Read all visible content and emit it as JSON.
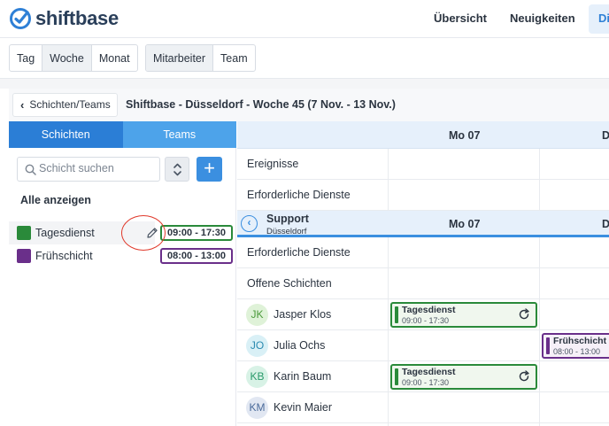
{
  "app": {
    "brand": "shiftbase"
  },
  "topnav": {
    "links": [
      "Übersicht",
      "Neuigkeiten",
      "Di"
    ]
  },
  "toolbar": {
    "view_modes": [
      "Tag",
      "Woche",
      "Monat"
    ],
    "view_active": "Woche",
    "group_modes": [
      "Mitarbeiter",
      "Team"
    ],
    "group_active": "Mitarbeiter"
  },
  "breadcrumb": {
    "back_label": "Schichten/Teams",
    "title": "Shiftbase - Düsseldorf - Woche 45 (7 Nov. - 13 Nov.)"
  },
  "left": {
    "tabs": [
      "Schichten",
      "Teams"
    ],
    "search_placeholder": "Schicht suchen",
    "show_all": "Alle anzeigen",
    "shifts": [
      {
        "name": "Tagesdienst",
        "time": "09:00 - 17:30",
        "color": "#2a8a3a"
      },
      {
        "name": "Frühschicht",
        "time": "08:00 - 13:00",
        "color": "#6a2f8a"
      }
    ]
  },
  "grid": {
    "days": [
      "Mo 07",
      "D"
    ],
    "rows_top": [
      "Ereignisse",
      "Erforderliche Dienste"
    ],
    "section": {
      "title": "Support",
      "subtitle": "Düsseldorf",
      "days": [
        "Mo 07",
        "D"
      ]
    },
    "rows_section": [
      "Erforderliche Dienste",
      "Offene Schichten"
    ],
    "employees": [
      {
        "initials": "JK",
        "name": "Jasper Klos",
        "avatar_bg": "#dff2d8",
        "avatar_fg": "#4a9a3a"
      },
      {
        "initials": "JO",
        "name": "Julia Ochs",
        "avatar_bg": "#d9f0f6",
        "avatar_fg": "#2a8ab0"
      },
      {
        "initials": "KB",
        "name": "Karin Baum",
        "avatar_bg": "#d8f2e6",
        "avatar_fg": "#2a9a6a"
      },
      {
        "initials": "KM",
        "name": "Kevin Maier",
        "avatar_bg": "#e1e7f2",
        "avatar_fg": "#4a6a9a"
      }
    ],
    "shift_cards": [
      {
        "title": "Tagesdienst",
        "time": "09:00 - 17:30",
        "color": "#2a8a3a"
      },
      {
        "title": "Frühschicht",
        "time": "08:00 - 13:00",
        "color": "#6a2f8a"
      },
      {
        "title": "Tagesdienst",
        "time": "09:00 - 17:30",
        "color": "#2a8a3a"
      }
    ]
  }
}
